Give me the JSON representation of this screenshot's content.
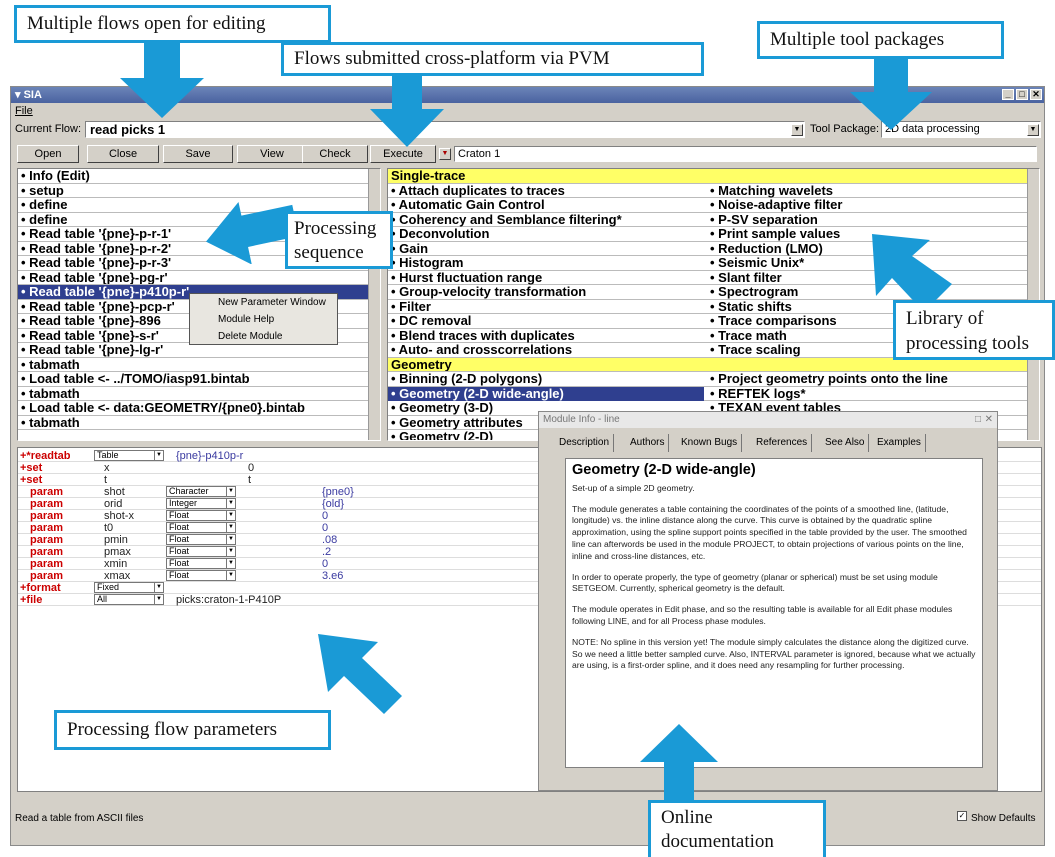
{
  "annotations": {
    "multiple_flows": "Multiple flows open for editing",
    "pvm": "Flows submitted cross-platform via PVM",
    "tool_packages": "Multiple tool packages",
    "processing_sequence": "Processing sequence",
    "library": "Library of processing tools",
    "flow_params": "Processing flow parameters",
    "online_docs": "Online documentation"
  },
  "window": {
    "title": "SIA",
    "menu_file": "File",
    "current_flow_label": "Current Flow:",
    "current_flow_value": "read picks 1",
    "tool_package_label": "Tool Package:",
    "tool_package_value": "2D data processing",
    "buttons": {
      "open": "Open",
      "close": "Close",
      "save": "Save",
      "view": "View",
      "check": "Check",
      "execute": "Execute"
    },
    "host_value": "Craton 1",
    "status_text": "Read a table from ASCII files",
    "show_defaults": "Show Defaults"
  },
  "flow_items": [
    "• Info (Edit)",
    "• setup",
    "• define",
    "• define",
    "• Read table '{pne}-p-r-1'",
    "• Read table '{pne}-p-r-2'",
    "• Read table '{pne}-p-r-3'",
    "• Read table '{pne}-pg-r'",
    "• Read table '{pne}-p410p-r'",
    "• Read table '{pne}-pcp-r'",
    "• Read table '{pne}-896",
    "• Read table '{pne}-s-r'",
    "• Read table '{pne}-lg-r'",
    "• tabmath",
    "• Load table <- ../TOMO/iasp91.bintab",
    "• tabmath",
    "• Load table <- data:GEOMETRY/{pne0}.bintab",
    "• tabmath"
  ],
  "selected_flow_index": 8,
  "context_menu": [
    "New Parameter Window",
    "Module Help",
    "Delete Module"
  ],
  "library": {
    "header1": "Single-trace",
    "left1": [
      "• Attach duplicates to traces",
      "• Automatic Gain Control",
      "• Coherency and Semblance filtering*",
      "• Deconvolution",
      "• Gain",
      "• Histogram",
      "• Hurst fluctuation range",
      "• Group-velocity transformation",
      "• Filter",
      "• DC removal",
      "• Blend traces with duplicates",
      "• Auto- and crosscorrelations"
    ],
    "right1": [
      "• Matching wavelets",
      "• Noise-adaptive filter",
      "• P-SV separation",
      "• Print sample values",
      "• Reduction (LMO)",
      "• Seismic Unix*",
      "• Slant filter",
      "• Spectrogram",
      "• Static shifts",
      "• Trace comparisons",
      "• Trace math",
      "• Trace scaling"
    ],
    "header2": "Geometry",
    "left2": [
      "• Binning (2-D polygons)",
      "• Geometry (2-D wide-angle)",
      "• Geometry (3-D)",
      "• Geometry attributes",
      "• Geometry (2-D)"
    ],
    "right2": [
      "• Project geometry points onto the line",
      "• REFTEK logs*",
      "• TEXAN event tables",
      "",
      ""
    ],
    "selected_left2_index": 1
  },
  "params": {
    "r0": {
      "key": "+*readtab",
      "type": "Table",
      "name": "{pne}-p410p-r"
    },
    "r1": {
      "key": "+set",
      "name": "x",
      "val": "0"
    },
    "r2": {
      "key": "+set",
      "name": "t",
      "val": "t"
    },
    "r3": {
      "key": "param",
      "name": "shot",
      "type": "Character",
      "val": "{pne0}"
    },
    "r4": {
      "key": "param",
      "name": "orid",
      "type": "Integer",
      "val": "{old}"
    },
    "r5": {
      "key": "param",
      "name": "shot-x",
      "type": "Float",
      "val": "0"
    },
    "r6": {
      "key": "param",
      "name": "t0",
      "type": "Float",
      "val": "0"
    },
    "r7": {
      "key": "param",
      "name": "pmin",
      "type": "Float",
      "val": ".08"
    },
    "r8": {
      "key": "param",
      "name": "pmax",
      "type": "Float",
      "val": ".2"
    },
    "r9": {
      "key": "param",
      "name": "xmin",
      "type": "Float",
      "val": "0"
    },
    "r10": {
      "key": "param",
      "name": "xmax",
      "type": "Float",
      "val": "3.e6"
    },
    "r11": {
      "key": "+format",
      "type": "Fixed"
    },
    "r12": {
      "key": "+file",
      "type": "All",
      "name": "picks:craton-1-P410P"
    }
  },
  "dialog": {
    "title": "Module Info - line",
    "tabs": [
      "Description",
      "Authors",
      "Known Bugs",
      "References",
      "See Also",
      "Examples"
    ],
    "heading": "Geometry (2-D wide-angle)",
    "p1": "Set-up of a simple 2D geometry.",
    "p2": "The module generates a table containing the coordinates of the points of a smoothed line, (latitude, longitude) vs. the inline distance along the curve. This curve is obtained by the quadratic spline approximation, using the spline support points specified in the table provided by the user. The smoothed line can afterwords be used in the module PROJECT, to obtain projections of various points on the line, inline and cross-line distances, etc.",
    "p3": "In order to operate properly, the type of geometry (planar or spherical) must be set using module SETGEOM. Currently, spherical geometry is the default.",
    "p4": "The module operates in Edit phase, and so the resulting table is available for all Edit phase modules following LINE, and for all Process phase modules.",
    "p5": "NOTE: No spline in this version yet! The module simply calculates the distance along the digitized curve. So we need a little better sampled curve. Also, INTERVAL parameter is ignored, because what we actually are using, is a first-order spline, and it does need any resampling for further processing."
  },
  "colors": {
    "accent": "#1a9ad6",
    "selection": "#2f3f8f",
    "header_fill": "#ffff66",
    "param_key": "#c00000"
  }
}
